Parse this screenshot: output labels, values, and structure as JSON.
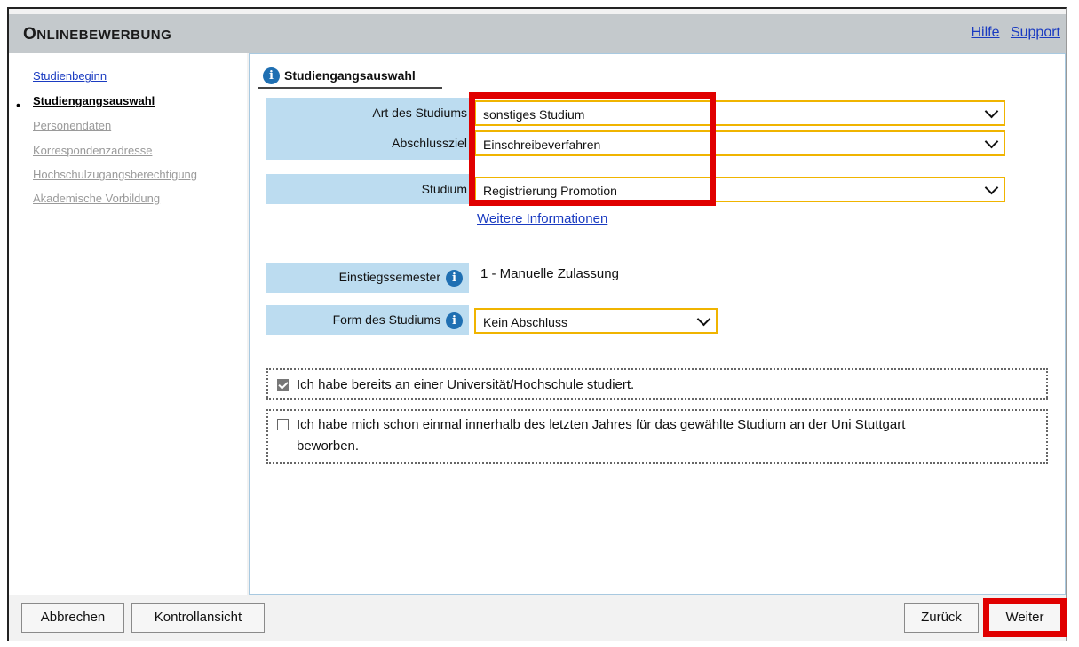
{
  "header": {
    "title_initial": "O",
    "title_rest": "NLINEBEWERBUNG",
    "links": [
      "Hilfe",
      "Support"
    ]
  },
  "sidebar": {
    "items": [
      {
        "label": "Studienbeginn",
        "state": "link"
      },
      {
        "label": "Studiengangsauswahl",
        "state": "active"
      },
      {
        "label": "Personendaten",
        "state": "disabled"
      },
      {
        "label": "Korrespondenzadresse",
        "state": "disabled"
      },
      {
        "label": "Hochschulzugangsberechtigung",
        "state": "disabled"
      },
      {
        "label": "Akademische Vorbildung",
        "state": "disabled"
      }
    ]
  },
  "section": {
    "title": "Studiengangsauswahl",
    "info_icon": "info-icon"
  },
  "form": {
    "art_label": "Art des Studiums",
    "art_value": "sonstiges Studium",
    "abschluss_label": "Abschlussziel",
    "abschluss_value": "Einschreibeverfahren",
    "studium_label": "Studium",
    "studium_value": "Registrierung Promotion",
    "more_info": "Weitere Informationen",
    "semester_label": "Einstiegssemester",
    "semester_value": "1 - Manuelle Zulassung",
    "form_label": "Form des Studiums",
    "form_value": "Kein Abschluss"
  },
  "checkboxes": [
    {
      "label": "Ich habe bereits an einer Universität/Hochschule studiert.",
      "checked": true
    },
    {
      "label_line1": "Ich habe mich schon einmal innerhalb des letzten Jahres für das gewählte Studium an der Uni Stuttgart",
      "label_line2": "beworben.",
      "checked": false
    }
  ],
  "footer": {
    "cancel": "Abbrechen",
    "control": "Kontrollansicht",
    "back": "Zurück",
    "next": "Weiter"
  },
  "colors": {
    "highlight": "#e00000",
    "select_border": "#f0b400",
    "label_bg": "#bcdcf0",
    "link": "#1a3bc1"
  }
}
